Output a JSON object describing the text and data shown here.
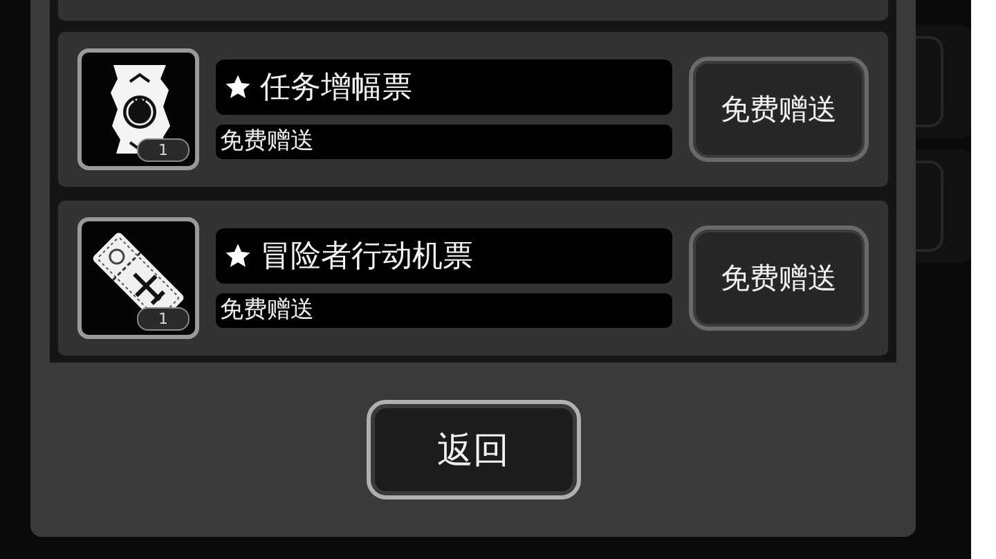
{
  "items": [
    {
      "kind": "scroll",
      "name": "任务增幅票",
      "subtitle": "免费赠送",
      "count": "1",
      "button": "免费赠送"
    },
    {
      "kind": "ticket",
      "name": "冒险者行动机票",
      "subtitle": "免费赠送",
      "count": "1",
      "button": "免费赠送"
    }
  ],
  "back_button": "返回"
}
